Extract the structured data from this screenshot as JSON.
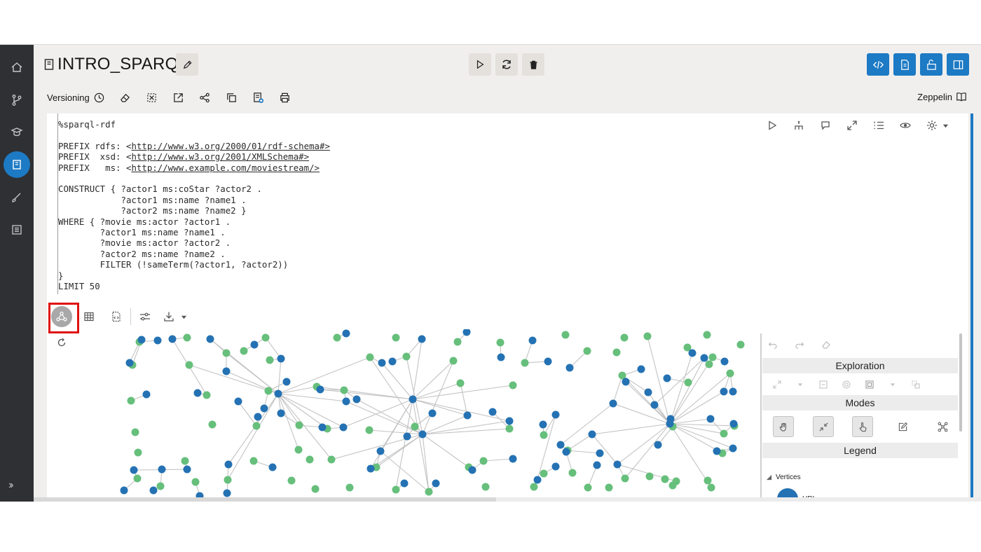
{
  "notebook": {
    "title": "INTRO_SPARQL"
  },
  "toolbar": {
    "versioning_label": "Versioning",
    "zeppelin_label": "Zeppelin"
  },
  "paragraph": {
    "code_lines": [
      "%sparql-rdf",
      "",
      "PREFIX rdfs: <http://www.w3.org/2000/01/rdf-schema#>",
      "PREFIX  xsd: <http://www.w3.org/2001/XMLSchema#>",
      "PREFIX   ms: <http://www.example.com/moviestream/>",
      "",
      "CONSTRUCT { ?actor1 ms:coStar ?actor2 .",
      "            ?actor1 ms:name ?name1 .",
      "            ?actor2 ms:name ?name2 }",
      "WHERE { ?movie ms:actor ?actor1 .",
      "        ?actor1 ms:name ?name1 .",
      "        ?movie ms:actor ?actor2 .",
      "        ?actor2 ms:name ?name2 .",
      "        FILTER (!sameTerm(?actor1, ?actor2))",
      "}",
      "LIMIT 50"
    ]
  },
  "graph_panel": {
    "exploration_label": "Exploration",
    "modes_label": "Modes",
    "legend_label": "Legend",
    "vertices_label": "Vertices",
    "legend_items": [
      {
        "label": "URI",
        "color": "#2472b3"
      }
    ]
  },
  "colors": {
    "sidebar": "#2f3033",
    "accent": "#1d7ac4",
    "node_uri": "#2472b3",
    "node_literal": "#66bf7b",
    "edge": "#c3c3c3",
    "highlight": "#e01010"
  }
}
